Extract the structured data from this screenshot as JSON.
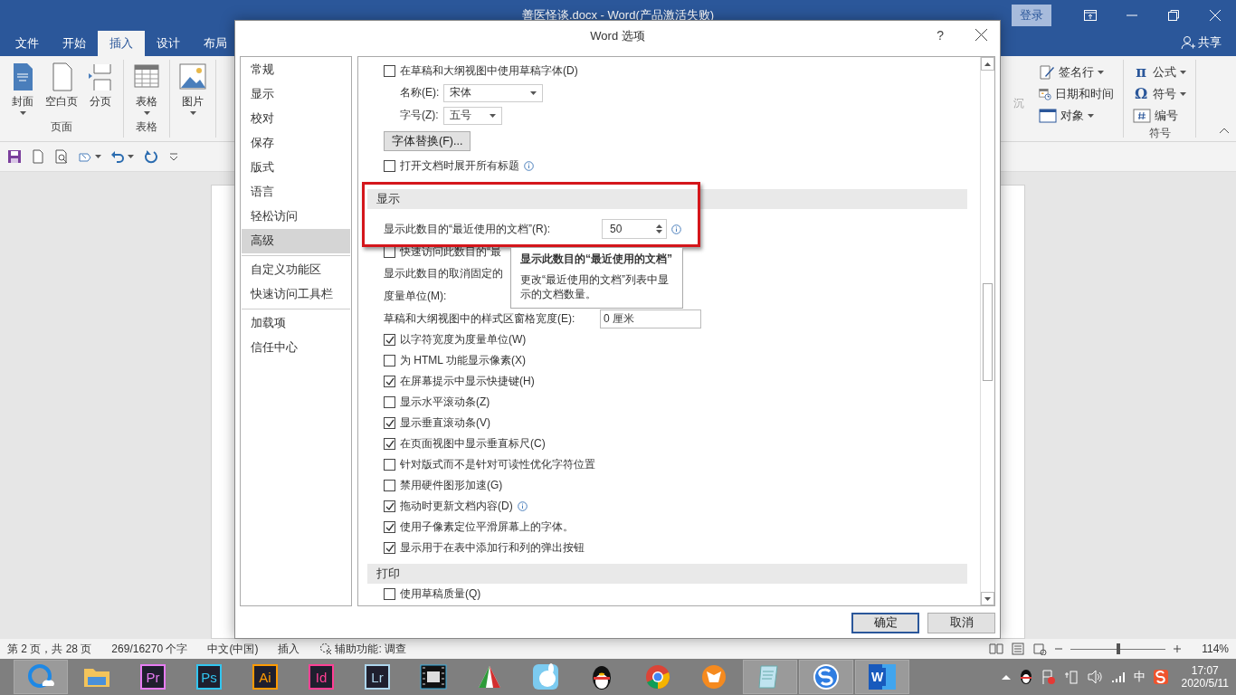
{
  "app": {
    "title": "善医怪谈.docx - Word(产品激活失败)",
    "login": "登录",
    "share": "共享"
  },
  "ribbon_tabs": [
    {
      "label": "文件",
      "selected": false
    },
    {
      "label": "开始",
      "selected": false
    },
    {
      "label": "插入",
      "selected": true
    },
    {
      "label": "设计",
      "selected": false
    },
    {
      "label": "布局",
      "selected": false
    }
  ],
  "ribbon_left": [
    {
      "label": "页面",
      "items": [
        {
          "kind": "cover",
          "label": "封面",
          "dropdown": true
        },
        {
          "kind": "blank",
          "label": "空白页",
          "dropdown": false
        },
        {
          "kind": "break",
          "label": "分页",
          "dropdown": false
        }
      ]
    },
    {
      "label": "表格",
      "items": [
        {
          "kind": "table",
          "label": "表格",
          "dropdown": true
        }
      ]
    },
    {
      "items": [
        {
          "kind": "picture",
          "label": "图片",
          "dropdown": true
        }
      ]
    }
  ],
  "ribbon_cut_text": "沉",
  "ribbon_right": [
    {
      "items": [
        {
          "kind": "signature",
          "label": "签名行",
          "dropdown": true
        },
        {
          "kind": "datetime",
          "label": "日期和时间",
          "dropdown": false
        },
        {
          "kind": "object",
          "label": "对象",
          "dropdown": true
        }
      ]
    },
    {
      "label": "符号",
      "items": [
        {
          "kind": "glyph",
          "glyph": "π",
          "label": "公式",
          "dropdown": true
        },
        {
          "kind": "glyph",
          "glyph": "Ω",
          "label": "符号",
          "dropdown": true
        },
        {
          "kind": "number",
          "label": "编号",
          "dropdown": false
        }
      ]
    }
  ],
  "quick_access": [
    {
      "kind": "save",
      "dropdown": false
    },
    {
      "kind": "new",
      "dropdown": false
    },
    {
      "kind": "preview",
      "dropdown": false
    },
    {
      "kind": "shape",
      "dropdown": true
    },
    {
      "kind": "undo",
      "dropdown": true
    },
    {
      "kind": "redo",
      "dropdown": false
    },
    {
      "kind": "customize",
      "dropdown": false
    }
  ],
  "dialog": {
    "title": "Word 选项",
    "help": "?",
    "nav_groups": [
      {
        "items": [
          {
            "label": "常规",
            "selected": false
          },
          {
            "label": "显示",
            "selected": false
          },
          {
            "label": "校对",
            "selected": false
          },
          {
            "label": "保存",
            "selected": false
          },
          {
            "label": "版式",
            "selected": false
          },
          {
            "label": "语言",
            "selected": false
          },
          {
            "label": "轻松访问",
            "selected": false
          },
          {
            "label": "高级",
            "selected": true
          }
        ]
      },
      {
        "items": [
          {
            "label": "自定义功能区",
            "selected": false
          },
          {
            "label": "快速访问工具栏",
            "selected": false
          }
        ]
      },
      {
        "items": [
          {
            "label": "加载项",
            "selected": false
          },
          {
            "label": "信任中心",
            "selected": false
          }
        ]
      }
    ],
    "rows": [
      {
        "kind": "checkbox",
        "label": "在草稿和大纲视图中使用草稿字体(D)",
        "checked": false,
        "info": false
      },
      {
        "kind": "select",
        "label": "名称(E):",
        "value": "宋体",
        "wide": true
      },
      {
        "kind": "select",
        "label": "字号(Z):",
        "value": "五号",
        "wide": false
      },
      {
        "kind": "button",
        "label": "字体替换(F)..."
      },
      {
        "kind": "checkbox",
        "label": "打开文档时展开所有标题",
        "checked": false,
        "info": true
      },
      {
        "kind": "highlight",
        "rows": [
          {
            "kind": "header",
            "label": "显示"
          },
          {
            "kind": "spin",
            "label": "显示此数目的“最近使用的文档”(R):",
            "value": "50",
            "info": true
          }
        ]
      },
      {
        "kind": "checkbox",
        "label": "快速访问此数目的“最",
        "checked": false,
        "info": false
      },
      {
        "kind": "text",
        "label": "显示此数目的取消固定的"
      },
      {
        "kind": "text",
        "label": "度量单位(M):"
      },
      {
        "kind": "field",
        "label": "草稿和大纲视图中的样式区窗格宽度(E):",
        "value": "0 厘米"
      },
      {
        "kind": "checkbox",
        "label": "以字符宽度为度量单位(W)",
        "checked": true,
        "info": false
      },
      {
        "kind": "checkbox",
        "label": "为 HTML 功能显示像素(X)",
        "checked": false,
        "info": false
      },
      {
        "kind": "checkbox",
        "label": "在屏幕提示中显示快捷键(H)",
        "checked": true,
        "info": false
      },
      {
        "kind": "checkbox",
        "label": "显示水平滚动条(Z)",
        "checked": false,
        "info": false
      },
      {
        "kind": "checkbox",
        "label": "显示垂直滚动条(V)",
        "checked": true,
        "info": false
      },
      {
        "kind": "checkbox",
        "label": "在页面视图中显示垂直标尺(C)",
        "checked": true,
        "info": false
      },
      {
        "kind": "checkbox",
        "label": "针对版式而不是针对可读性优化字符位置",
        "checked": false,
        "info": false
      },
      {
        "kind": "checkbox",
        "label": "禁用硬件图形加速(G)",
        "checked": false,
        "info": false
      },
      {
        "kind": "checkbox",
        "label": "拖动时更新文档内容(D)",
        "checked": true,
        "info": true
      },
      {
        "kind": "checkbox",
        "label": "使用子像素定位平滑屏幕上的字体。",
        "checked": true,
        "info": false
      },
      {
        "kind": "checkbox",
        "label": "显示用于在表中添加行和列的弹出按钮",
        "checked": true,
        "info": false
      },
      {
        "kind": "header",
        "label": "打印"
      },
      {
        "kind": "checkbox",
        "label": "使用草稿质量(Q)",
        "checked": false,
        "info": false
      }
    ],
    "tooltip": {
      "title": "显示此数目的“最近使用的文档”",
      "body": "更改“最近使用的文档”列表中显示的文档数量。"
    },
    "buttons": [
      {
        "label": "确定",
        "default": true
      },
      {
        "label": "取消",
        "default": false
      }
    ]
  },
  "status_bar": {
    "page": "第 2 页，共 28 页",
    "words": "269/16270 个字",
    "language": "中文(中国)",
    "mode": "插入",
    "accessibility": "辅助功能: 调查",
    "zoom": {
      "level": 0.5,
      "reading": "114%"
    }
  },
  "taskbar": [
    {
      "kind": "browser",
      "open": true
    },
    {
      "kind": "folder",
      "open": false
    },
    {
      "kind": "tile",
      "label": "Pr",
      "color": "#e77cf3",
      "open": false
    },
    {
      "kind": "tile",
      "label": "Ps",
      "color": "#31c5f0",
      "open": false
    },
    {
      "kind": "tile",
      "label": "Ai",
      "color": "#ff9a00",
      "open": false
    },
    {
      "kind": "tile",
      "label": "Id",
      "color": "#ff3f94",
      "open": false
    },
    {
      "kind": "tile",
      "label": "Lr",
      "color": "#add5ec",
      "open": false
    },
    {
      "kind": "film",
      "open": false
    },
    {
      "kind": "paint",
      "open": false
    },
    {
      "kind": "rabbit",
      "open": false
    },
    {
      "kind": "penguin",
      "open": false
    },
    {
      "kind": "chrome",
      "open": false
    },
    {
      "kind": "fox",
      "open": false
    },
    {
      "kind": "notepad",
      "open": true
    },
    {
      "kind": "sogou",
      "open": true
    },
    {
      "kind": "word",
      "label": "W",
      "open": true
    }
  ],
  "tray": {
    "input": "中",
    "time": "17:07",
    "date": "2020/5/11"
  }
}
